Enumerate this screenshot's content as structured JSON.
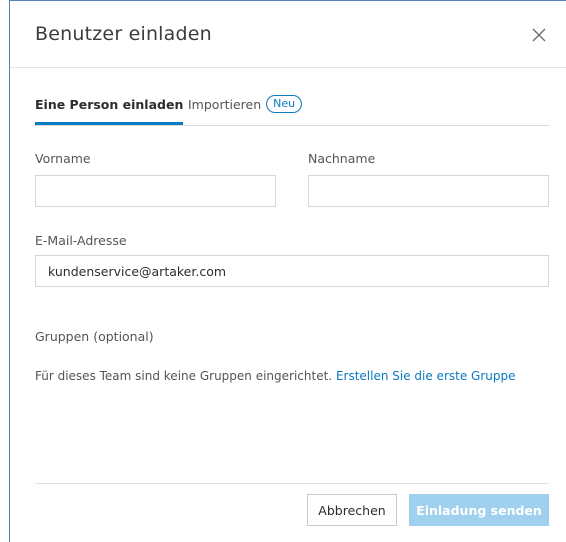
{
  "dialog": {
    "title": "Benutzer einladen",
    "close_icon": "close-icon"
  },
  "tabs": [
    {
      "label": "Eine Person einladen",
      "active": true
    },
    {
      "label": "Importieren",
      "badge": "Neu",
      "active": false
    }
  ],
  "form": {
    "first_name": {
      "label": "Vorname",
      "value": "",
      "placeholder": ""
    },
    "last_name": {
      "label": "Nachname",
      "value": "",
      "placeholder": ""
    },
    "email": {
      "label": "E-Mail-Adresse",
      "value": "kundenservice@artaker.com"
    },
    "groups": {
      "label": "Gruppen (optional)",
      "info_text": "Für dieses Team sind keine Gruppen eingerichtet.",
      "link_text": "Erstellen Sie die erste Gruppe"
    }
  },
  "footer": {
    "cancel_label": "Abbrechen",
    "send_label": "Einladung senden",
    "send_disabled": true
  },
  "colors": {
    "accent": "#0a7ac2",
    "disabled_button": "#9fd0ee"
  }
}
